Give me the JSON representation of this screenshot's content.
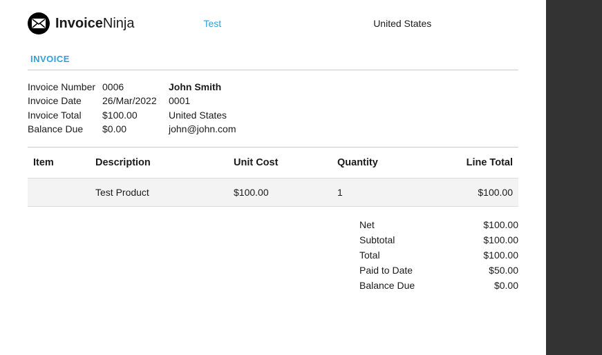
{
  "logo": {
    "bold": "Invoice",
    "regular": "Ninja"
  },
  "header": {
    "link_text": "Test",
    "right_text": "United States"
  },
  "doc_title": "INVOICE",
  "meta": {
    "labels": {
      "number": "Invoice Number",
      "date": "Invoice Date",
      "total": "Invoice Total",
      "balance": "Balance Due"
    },
    "values": {
      "number": "0006",
      "date": "26/Mar/2022",
      "total": "$100.00",
      "balance": "$0.00"
    }
  },
  "client": {
    "name": "John Smith",
    "code": "0001",
    "country": "United States",
    "email": "john@john.com"
  },
  "columns": {
    "item": "Item",
    "description": "Description",
    "unit_cost": "Unit Cost",
    "quantity": "Quantity",
    "line_total": "Line Total"
  },
  "line": {
    "item": "",
    "description": "Test Product",
    "unit_cost": "$100.00",
    "quantity": "1",
    "line_total": "$100.00"
  },
  "totals": {
    "net_label": "Net",
    "net": "$100.00",
    "subtotal_label": "Subtotal",
    "subtotal": "$100.00",
    "total_label": "Total",
    "total": "$100.00",
    "paid_label": "Paid to Date",
    "paid": "$50.00",
    "balance_label": "Balance Due",
    "balance": "$0.00"
  }
}
